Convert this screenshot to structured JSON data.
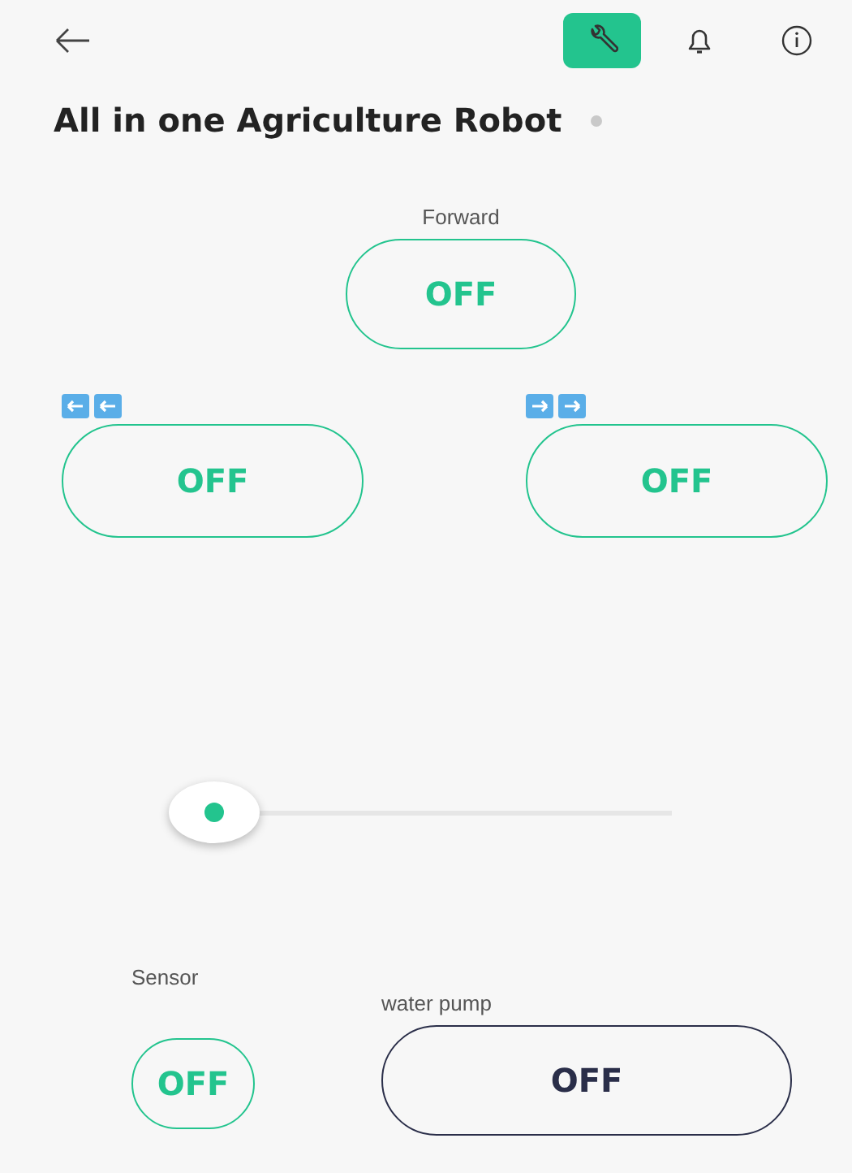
{
  "header": {
    "tools": [
      {
        "kind": "wrench",
        "selected": true
      },
      {
        "kind": "bell",
        "selected": false
      },
      {
        "kind": "info",
        "selected": false
      }
    ]
  },
  "title": "All in one Agriculture Robot",
  "online": false,
  "widgets": [
    {
      "kind": "button",
      "label": "Forward",
      "value": "OFF",
      "color": "#23c48e"
    },
    {
      "kind": "leftkeys",
      "value": "OFF",
      "color": "#23c48e"
    },
    {
      "kind": "rightkeys",
      "value": "OFF",
      "color": "#23c48e"
    },
    {
      "kind": "slider",
      "level": 0
    },
    {
      "kind": "button",
      "label": "Sensor",
      "value": "OFF",
      "color": "#23c48e"
    },
    {
      "kind": "button",
      "label": "water pump",
      "value": "OFF",
      "color": "#2a2e49"
    }
  ]
}
